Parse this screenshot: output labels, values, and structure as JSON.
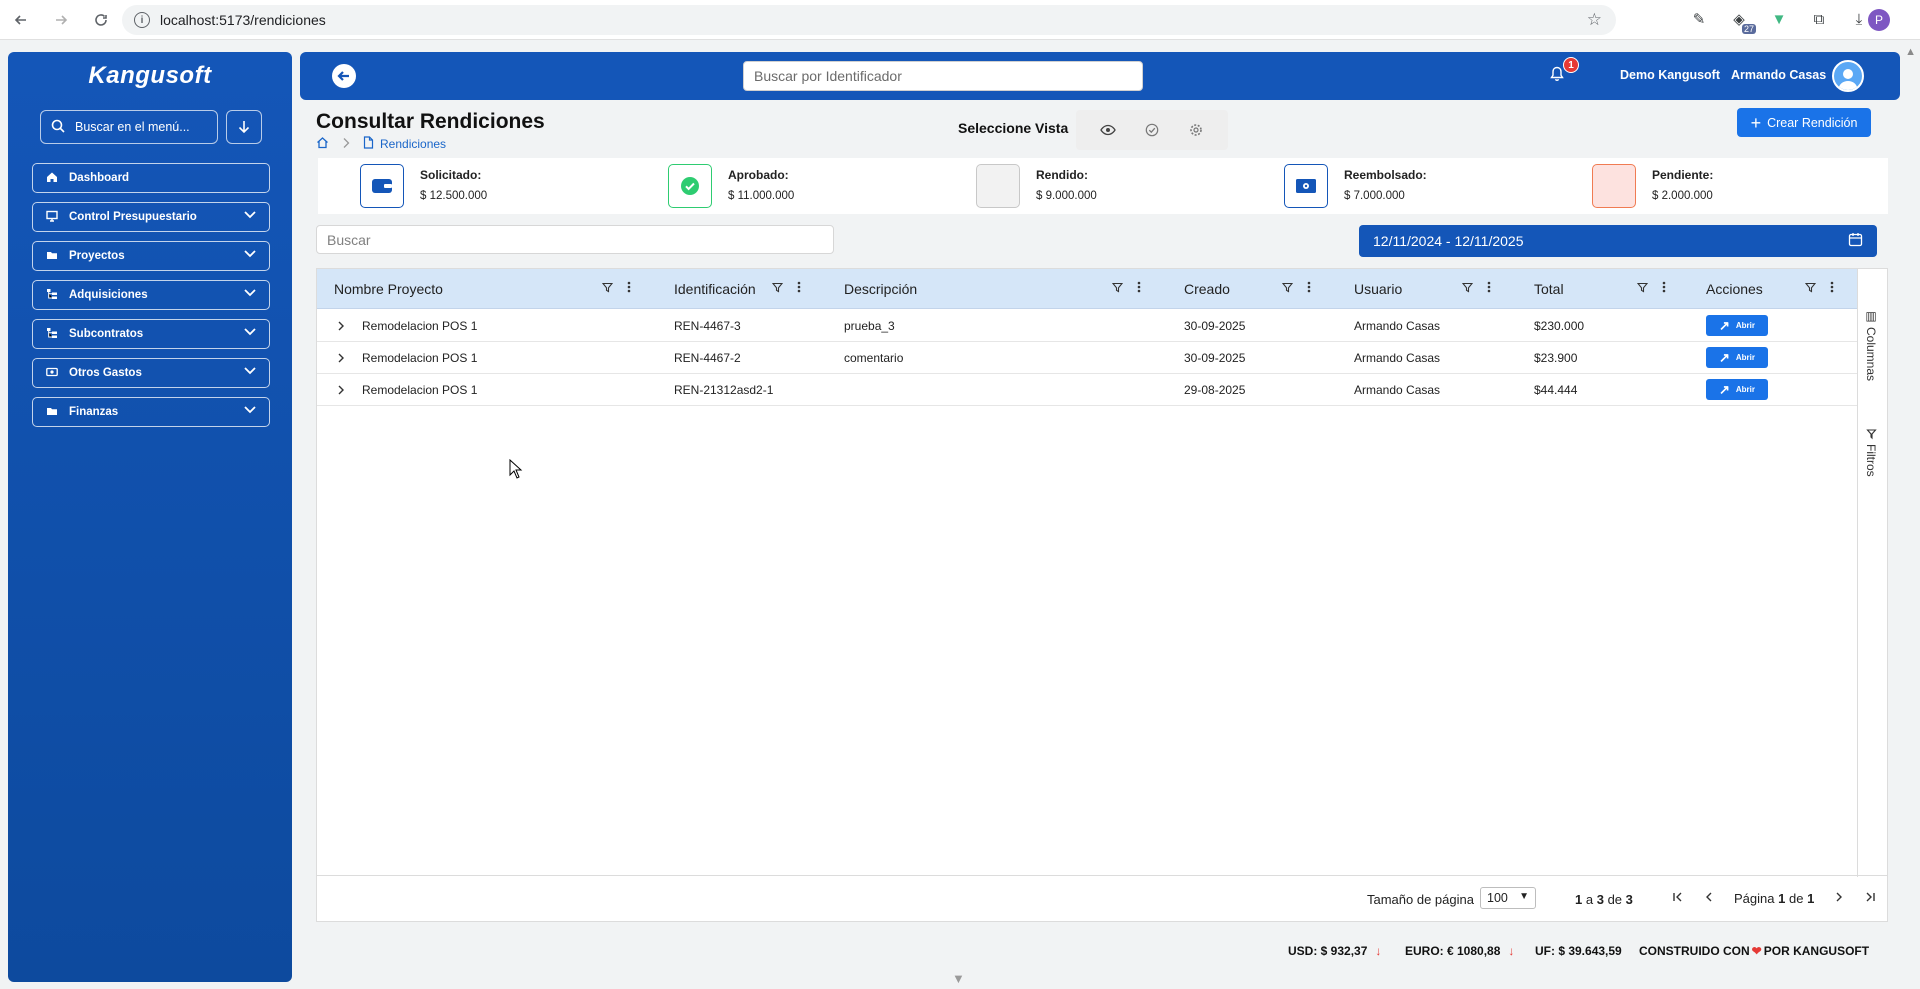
{
  "browser": {
    "url": "localhost:5173/rendiciones",
    "profile_initial": "P",
    "ext_badge": "27"
  },
  "sidebar": {
    "logo": "Kangusoft",
    "search_placeholder": "Buscar en el menú...",
    "items": [
      {
        "label": "Dashboard",
        "icon": "home-icon",
        "expandable": false
      },
      {
        "label": "Control Presupuestario",
        "icon": "monitor-icon",
        "expandable": true
      },
      {
        "label": "Proyectos",
        "icon": "folder-icon",
        "expandable": true
      },
      {
        "label": "Adquisiciones",
        "icon": "tree-icon",
        "expandable": true
      },
      {
        "label": "Subcontratos",
        "icon": "tree-icon",
        "expandable": true
      },
      {
        "label": "Otros Gastos",
        "icon": "money-icon",
        "expandable": true
      },
      {
        "label": "Finanzas",
        "icon": "folder-icon",
        "expandable": true
      }
    ]
  },
  "header": {
    "search_placeholder": "Buscar por Identificador",
    "notifications": "1",
    "company": "Demo Kangusoft",
    "user": "Armando Casas"
  },
  "page": {
    "title": "Consultar Rendiciones",
    "breadcrumb": "Rendiciones",
    "vista_label": "Seleccione Vista",
    "create_label": "Crear Rendición"
  },
  "stats": [
    {
      "label": "Solicitado:",
      "value": "$ 12.500.000",
      "icon": "wallet-icon",
      "color": "#1456b8"
    },
    {
      "label": "Aprobado:",
      "value": "$ 11.000.000",
      "icon": "check-circle-icon",
      "color": "#2ecc71"
    },
    {
      "label": "Rendido:",
      "value": "$ 9.000.000",
      "icon": "blank-icon",
      "color": "#c8c8c8"
    },
    {
      "label": "Reembolsado:",
      "value": "$ 7.000.000",
      "icon": "cash-icon",
      "color": "#1456b8"
    },
    {
      "label": "Pendiente:",
      "value": "$ 2.000.000",
      "icon": "blank-icon",
      "color": "#f07b52"
    }
  ],
  "filters": {
    "search_placeholder": "Buscar",
    "date_range": "12/11/2024 - 12/11/2025"
  },
  "table": {
    "columns": [
      "Nombre Proyecto",
      "Identificación",
      "Descripción",
      "Creado",
      "Usuario",
      "Total",
      "Acciones"
    ],
    "rows": [
      {
        "proyecto": "Remodelacion POS 1",
        "id": "REN-4467-3",
        "desc": "prueba_3",
        "creado": "30-09-2025",
        "usuario": "Armando Casas",
        "total": "$230.000"
      },
      {
        "proyecto": "Remodelacion POS 1",
        "id": "REN-4467-2",
        "desc": "comentario",
        "creado": "30-09-2025",
        "usuario": "Armando Casas",
        "total": "$23.900"
      },
      {
        "proyecto": "Remodelacion POS 1",
        "id": "REN-21312asd2-1",
        "desc": "",
        "creado": "29-08-2025",
        "usuario": "Armando Casas",
        "total": "$44.444"
      }
    ],
    "action_label": "Abrir",
    "side_columns": "Columnas",
    "side_filters": "Filtros"
  },
  "pagination": {
    "page_size_label": "Tamaño de página",
    "page_size": "100",
    "range_from": "1",
    "range_to": "3",
    "range_total": "3",
    "range_a": "a",
    "range_de": "de",
    "page_label": "Página",
    "page_current": "1",
    "page_de": "de",
    "page_total": "1"
  },
  "footer": {
    "usd": "USD: $ 932,37",
    "euro": "EURO: € 1080,88",
    "uf": "UF: $ 39.643,59",
    "built_pre": "CONSTRUIDO CON",
    "built_post": "POR KANGUSOFT"
  }
}
